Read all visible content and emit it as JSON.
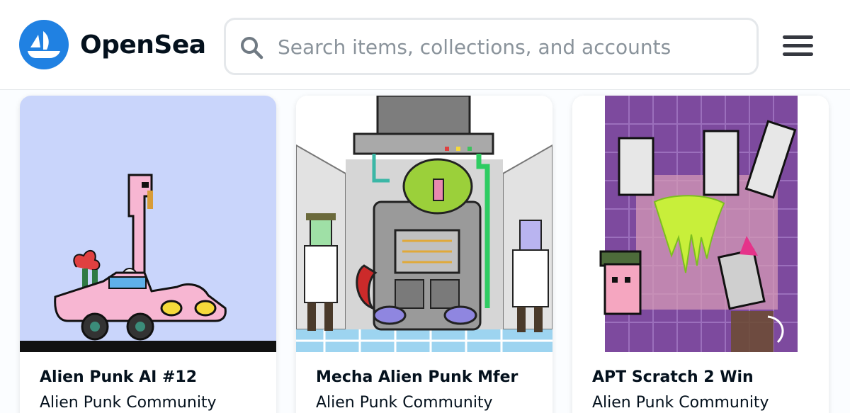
{
  "header": {
    "brand_name": "OpenSea",
    "search": {
      "placeholder": "Search items, collections, and accounts",
      "value": ""
    },
    "icons": {
      "logo": "opensea-boat-logo",
      "search": "search-icon",
      "menu": "hamburger-menu-icon"
    }
  },
  "cards": [
    {
      "title": "Alien Punk AI #12",
      "collection": "Alien Punk Community"
    },
    {
      "title": "Mecha Alien Punk Mfer",
      "collection": "Alien Punk Community"
    },
    {
      "title": "APT Scratch 2 Win",
      "collection": "Alien Punk Community"
    }
  ],
  "colors": {
    "brand_blue": "#2081e2",
    "text": "#04111d",
    "placeholder": "#8a939b",
    "border": "#e5e8eb"
  }
}
